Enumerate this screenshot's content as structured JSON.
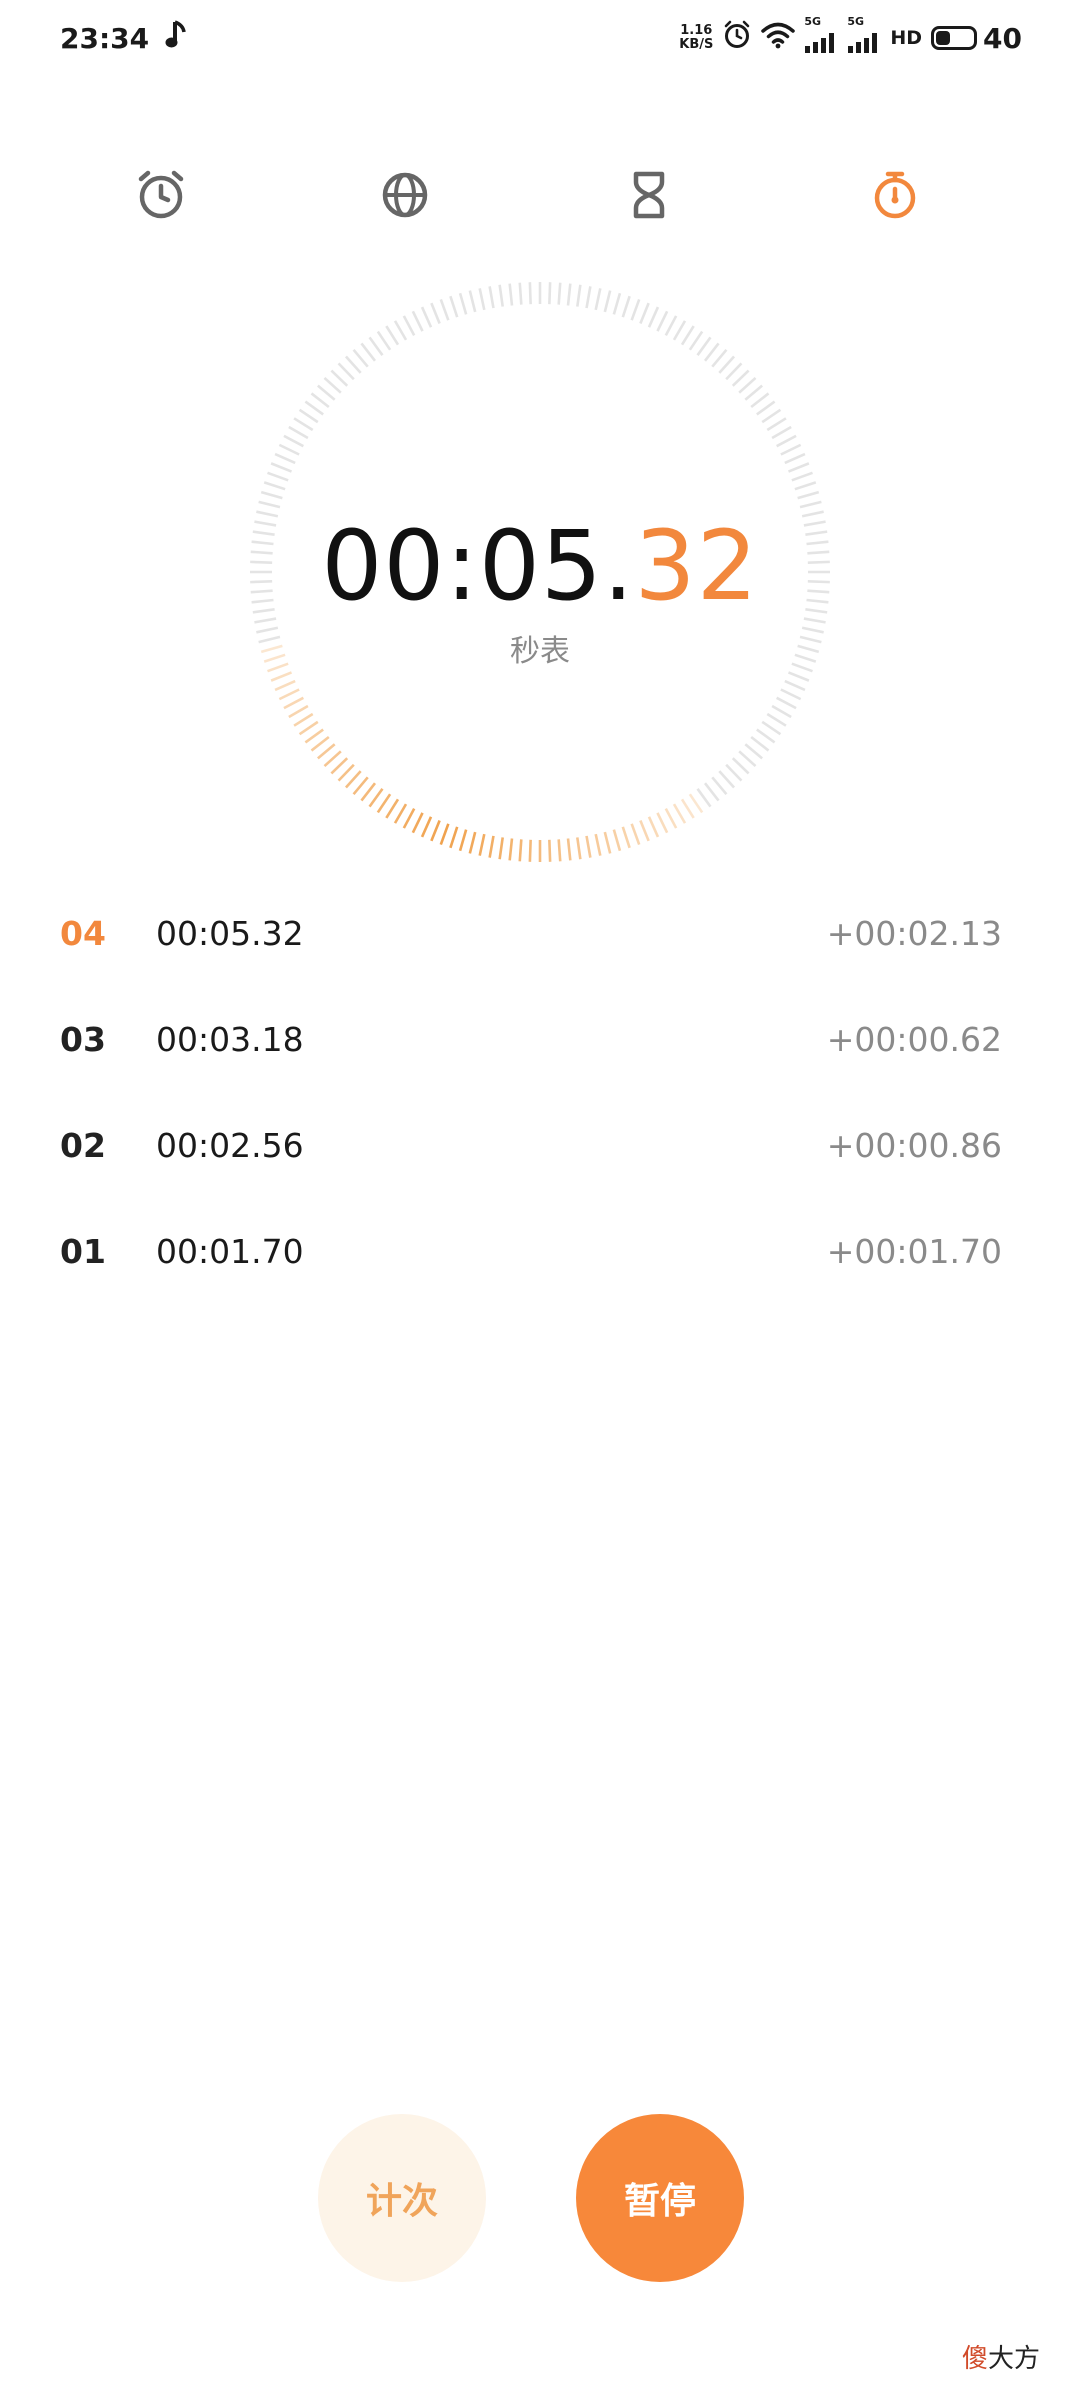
{
  "status_bar": {
    "time": "23:34",
    "net_speed_value": "1.16",
    "net_speed_unit": "KB/S",
    "sim1_gen": "5G",
    "sim2_gen": "5G",
    "hd_label": "HD",
    "battery_level": 40,
    "battery_text": "40"
  },
  "tabs": [
    {
      "id": "alarm",
      "icon": "alarm-clock-icon",
      "active": false
    },
    {
      "id": "world",
      "icon": "globe-icon",
      "active": false
    },
    {
      "id": "timer",
      "icon": "hourglass-icon",
      "active": false
    },
    {
      "id": "stopwatch",
      "icon": "stopwatch-icon",
      "active": true
    }
  ],
  "stopwatch": {
    "time_main": "00:05.",
    "time_fraction": "32",
    "mode_label": "秒表"
  },
  "laps": [
    {
      "index": "04",
      "total": "00:05.32",
      "diff": "+00:02.13",
      "current": true
    },
    {
      "index": "03",
      "total": "00:03.18",
      "diff": "+00:00.62",
      "current": false
    },
    {
      "index": "02",
      "total": "00:02.56",
      "diff": "+00:00.86",
      "current": false
    },
    {
      "index": "01",
      "total": "00:01.70",
      "diff": "+00:01.70",
      "current": false
    }
  ],
  "buttons": {
    "lap_label": "计次",
    "pause_label": "暂停"
  },
  "watermark": {
    "first_char": "傻",
    "rest": "大方"
  },
  "colors": {
    "accent": "#f2883d",
    "tick_inactive": "#e4e4e4",
    "tick_active": "#f0a24e",
    "lap_button_bg": "#fdf4e8",
    "pause_button_bg": "#f7883a"
  }
}
